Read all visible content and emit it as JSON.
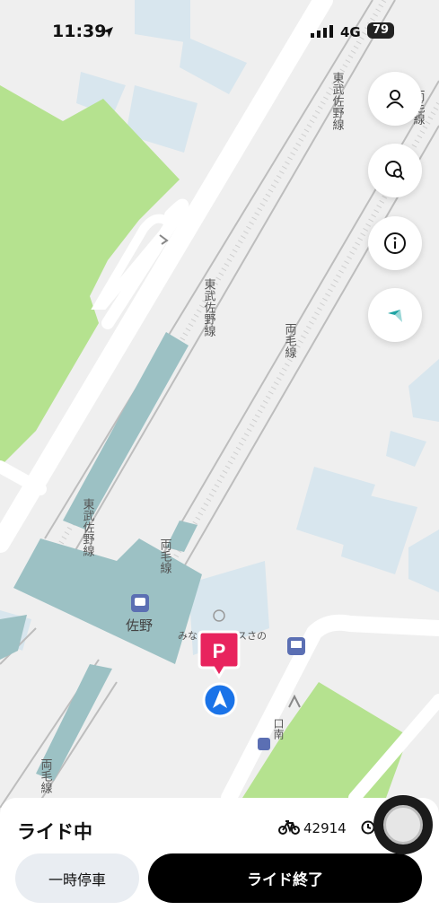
{
  "status_bar": {
    "time": "11:39",
    "network": "4G",
    "battery": "79"
  },
  "map": {
    "labels": {
      "tobu_sano_line": "東武佐野線",
      "ryomo_line": "両毛線",
      "station": "佐野",
      "facility": "みなとサービスさの",
      "exit": "口南"
    }
  },
  "side_buttons": [
    "person-icon",
    "search-location-icon",
    "info-icon",
    "compass-icon"
  ],
  "ride": {
    "status": "ライド中",
    "bike_number": "42914",
    "pause_label": "一時停車",
    "end_label": "ライド終了"
  },
  "colors": {
    "park": "#b5e28f",
    "rail_platform": "#9cc1c4",
    "building": "#d3e3ec",
    "parking_pin": "#e8245e",
    "location": "#1a73e8"
  }
}
